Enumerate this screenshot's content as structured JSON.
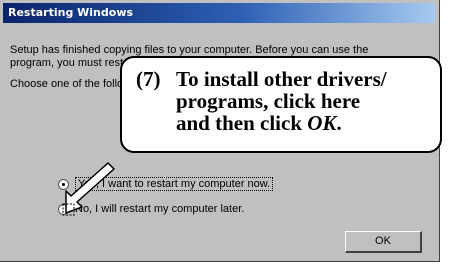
{
  "dialog": {
    "title": "Restarting Windows",
    "message": "Setup has finished copying files to your computer. Before you can use the program, you must restart Windows or your computer.",
    "prompt": "Choose one of the following options and click OK.",
    "options": [
      {
        "label": "Yes, I want to restart my computer now.",
        "selected": true
      },
      {
        "label": "No, I will restart my computer later.",
        "selected": false
      }
    ],
    "ok_label": "OK"
  },
  "callout": {
    "number": "(7)",
    "line1": "To install other drivers/",
    "line2": "programs, click here",
    "line3_prefix": "and then click ",
    "line3_em": "OK",
    "line3_suffix": "."
  }
}
